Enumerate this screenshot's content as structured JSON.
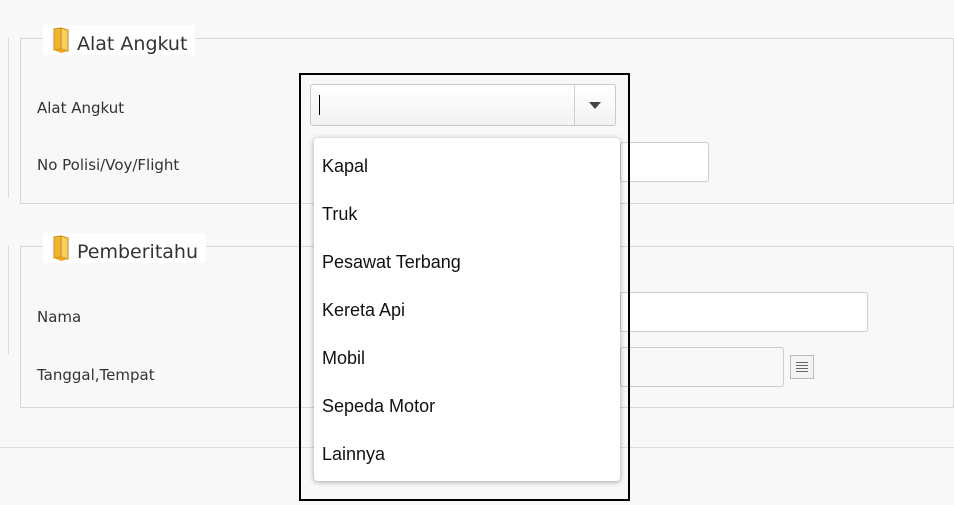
{
  "alat_angkut_section": {
    "legend": "Alat Angkut",
    "label_alat_angkut": "Alat Angkut",
    "label_no_polisi": "No Polisi/Voy/Flight",
    "combo_value": ""
  },
  "pemberitahu_section": {
    "legend": "Pemberitahu",
    "label_nama": "Nama",
    "label_tanggal": "Tanggal,Tempat"
  },
  "dropdown": {
    "options": [
      "Kapal",
      "Truk",
      "Pesawat Terbang",
      "Kereta Api",
      "Mobil",
      "Sepeda Motor",
      "Lainnya"
    ]
  },
  "icons": {
    "legend_icon": "folder-icon",
    "combo_arrow": "chevron-down-icon",
    "calendar": "calendar-icon"
  }
}
